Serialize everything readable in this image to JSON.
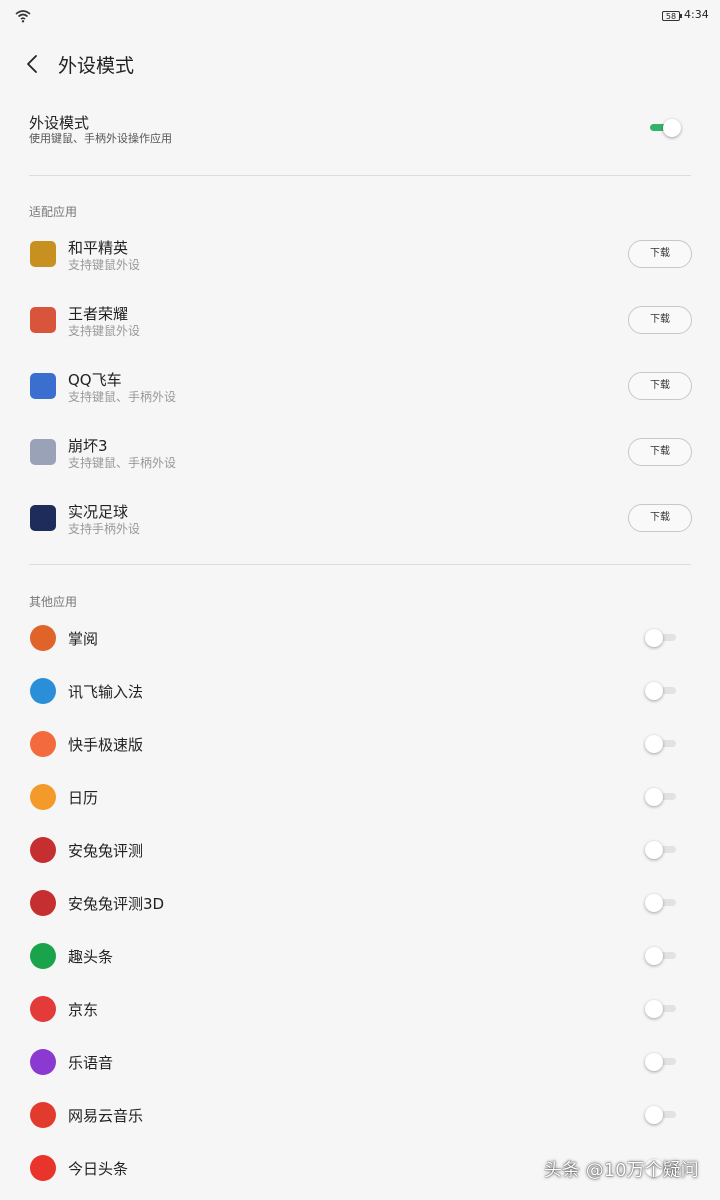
{
  "status_bar": {
    "battery": "58",
    "time": "4:34"
  },
  "header": {
    "title": "外设模式"
  },
  "main_setting": {
    "title": "外设模式",
    "subtitle": "使用键鼠、手柄外设操作应用",
    "enabled": true
  },
  "adapted_section": {
    "title": "适配应用",
    "apps": [
      {
        "name": "和平精英",
        "desc": "支持键鼠外设",
        "button": "下载",
        "icon": "peace-elite-icon",
        "color": "#c8901e"
      },
      {
        "name": "王者荣耀",
        "desc": "支持键鼠外设",
        "button": "下载",
        "icon": "honor-of-kings-icon",
        "color": "#d8543a"
      },
      {
        "name": "QQ飞车",
        "desc": "支持键鼠、手柄外设",
        "button": "下载",
        "icon": "qq-speed-icon",
        "color": "#3a6fd0"
      },
      {
        "name": "崩坏3",
        "desc": "支持键鼠、手柄外设",
        "button": "下载",
        "icon": "honkai-icon",
        "color": "#9aa2b8"
      },
      {
        "name": "实况足球",
        "desc": "支持手柄外设",
        "button": "下载",
        "icon": "efootball-icon",
        "color": "#1d2c5a"
      }
    ]
  },
  "other_section": {
    "title": "其他应用",
    "apps": [
      {
        "name": "掌阅",
        "enabled": false,
        "icon": "ireader-icon",
        "color": "#e0632a"
      },
      {
        "name": "讯飞输入法",
        "enabled": false,
        "icon": "ifly-icon",
        "color": "#2a8fd8"
      },
      {
        "name": "快手极速版",
        "enabled": false,
        "icon": "kuaishou-icon",
        "color": "#f36a3c"
      },
      {
        "name": "日历",
        "enabled": false,
        "icon": "calendar-icon",
        "color": "#f39a2a"
      },
      {
        "name": "安兔兔评测",
        "enabled": false,
        "icon": "antutu-icon",
        "color": "#c62f2f"
      },
      {
        "name": "安兔兔评测3D",
        "enabled": false,
        "icon": "antutu-3d-icon",
        "color": "#c62f2f"
      },
      {
        "name": "趣头条",
        "enabled": false,
        "icon": "qutoutiao-icon",
        "color": "#19a34a"
      },
      {
        "name": "京东",
        "enabled": false,
        "icon": "jd-icon",
        "color": "#e33a3a"
      },
      {
        "name": "乐语音",
        "enabled": false,
        "icon": "le-voice-icon",
        "color": "#8a3ad0"
      },
      {
        "name": "网易云音乐",
        "enabled": false,
        "icon": "netease-music-icon",
        "color": "#e23b2e"
      },
      {
        "name": "今日头条",
        "enabled": false,
        "icon": "toutiao-icon",
        "color": "#e8342a"
      }
    ]
  },
  "watermark": "头条 @10万个疑问"
}
